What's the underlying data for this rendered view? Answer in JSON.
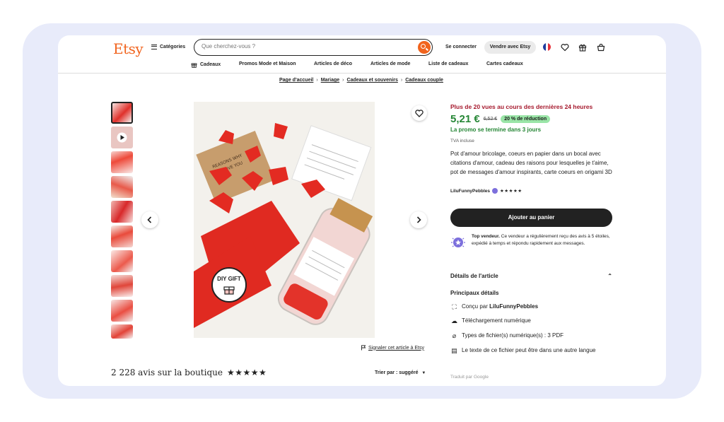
{
  "header": {
    "logo": "Etsy",
    "categories_label": "Catégories",
    "search_placeholder": "Que cherchez-vous ?",
    "signin_label": "Se connecter",
    "sell_label": "Vendre avec Etsy"
  },
  "nav": [
    "Cadeaux",
    "Promos Mode et Maison",
    "Articles de déco",
    "Articles de mode",
    "Liste de cadeaux",
    "Cartes cadeaux"
  ],
  "breadcrumb": [
    "Page d'accueil",
    "Mariage",
    "Cadeaux et souvenirs",
    "Cadeaux couple"
  ],
  "gallery": {
    "image_badge": "DIY GIFT",
    "report_label": "Signaler cet article à Etsy"
  },
  "listing": {
    "views_alert": "Plus de 20 vues au cours des dernières 24 heures",
    "price": "5,21 €",
    "old_price": "6,52 €",
    "discount": "20 % de réduction",
    "promo_end": "La promo se termine dans 3 jours",
    "tva": "TVA incluse",
    "title": "Pot d'amour bricolage, coeurs en papier dans un bocal avec citations d'amour, cadeau des raisons pour lesquelles je t'aime, pot de messages d'amour inspirants, carte coeurs en origami 3D",
    "seller": "LiluFunnyPebbles",
    "seller_stars": "★★★★★",
    "add_to_cart": "Ajouter au panier",
    "top_seller_title": "Top vendeur.",
    "top_seller_text": "Ce vendeur a régulièrement reçu des avis à 5 étoiles, expédié à temps et répondu rapidement aux messages.",
    "details_title": "Détails de l'article",
    "main_details": "Principaux détails",
    "details": [
      {
        "prefix": "Conçu par ",
        "bold": "LiluFunnyPebbles"
      },
      {
        "prefix": "Téléchargement numérique",
        "bold": ""
      },
      {
        "prefix": "Types de fichier(s) numérique(s) : 3 PDF",
        "bold": ""
      },
      {
        "prefix": "Le texte de ce fichier peut être dans une autre langue",
        "bold": ""
      }
    ],
    "translated_by": "Traduit par Google"
  },
  "reviews": {
    "summary": "2 228 avis sur la boutique",
    "stars": "★★★★★",
    "sort_label": "Trier par : suggéré"
  },
  "colors": {
    "brand": "#f1641e",
    "alert": "#a61a2e",
    "sale": "#258635",
    "discount_bg": "#9ae5a7",
    "frame_bg": "#e8ebfa"
  }
}
